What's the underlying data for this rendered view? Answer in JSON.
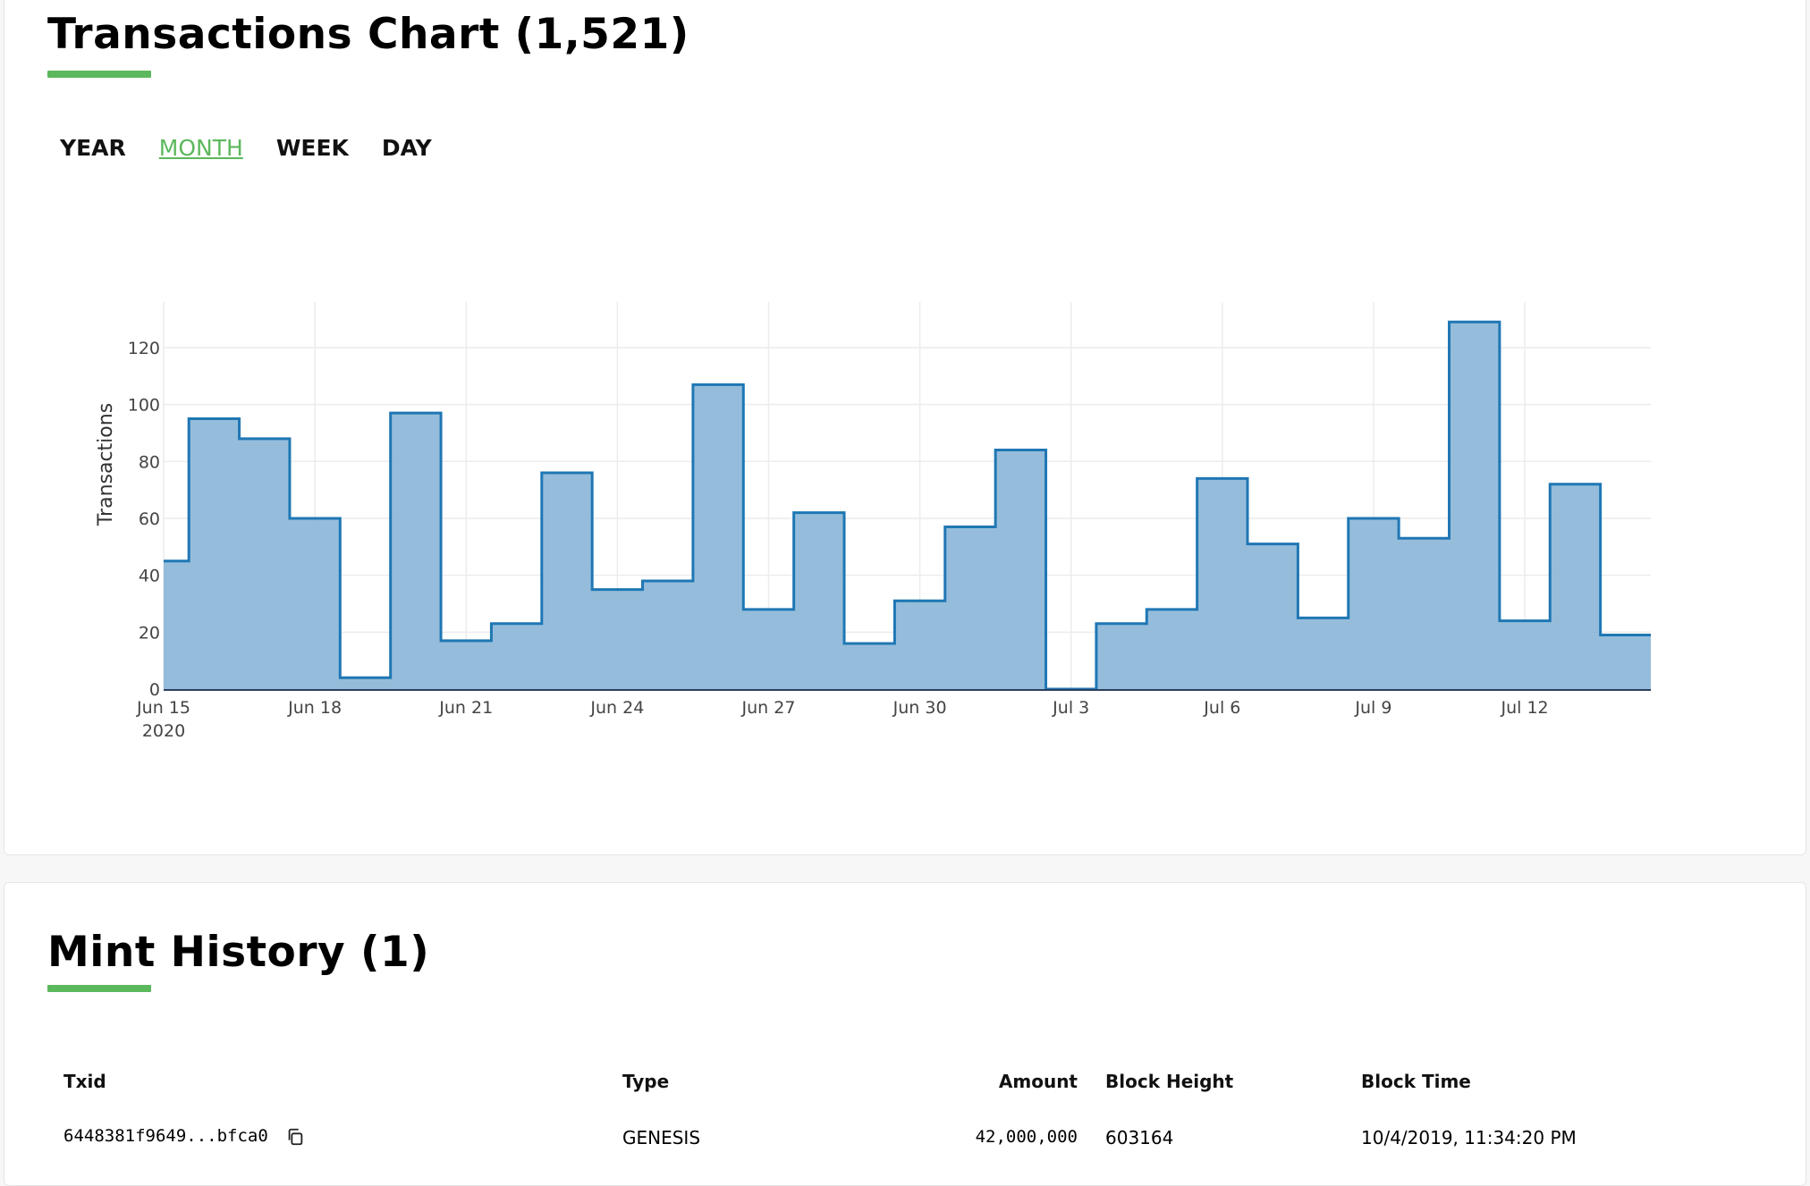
{
  "chart_card": {
    "title": "Transactions Chart (1,521)",
    "range_tabs": [
      {
        "label": "YEAR",
        "active": false
      },
      {
        "label": "MONTH",
        "active": true
      },
      {
        "label": "WEEK",
        "active": false
      },
      {
        "label": "DAY",
        "active": false
      }
    ]
  },
  "chart_data": {
    "type": "area",
    "step": true,
    "ylabel": "Transactions",
    "xlabel": "",
    "ylim": [
      0,
      136
    ],
    "yticks": [
      0,
      20,
      40,
      60,
      80,
      100,
      120
    ],
    "x_tick_labels": [
      "Jun 15",
      "Jun 18",
      "Jun 21",
      "Jun 24",
      "Jun 27",
      "Jun 30",
      "Jul 3",
      "Jul 6",
      "Jul 9",
      "Jul 12"
    ],
    "x_year_label": "2020",
    "dates": [
      "2020-06-15",
      "2020-06-16",
      "2020-06-17",
      "2020-06-18",
      "2020-06-19",
      "2020-06-20",
      "2020-06-21",
      "2020-06-22",
      "2020-06-23",
      "2020-06-24",
      "2020-06-25",
      "2020-06-26",
      "2020-06-27",
      "2020-06-28",
      "2020-06-29",
      "2020-06-30",
      "2020-07-01",
      "2020-07-02",
      "2020-07-03",
      "2020-07-04",
      "2020-07-05",
      "2020-07-06",
      "2020-07-07",
      "2020-07-08",
      "2020-07-09",
      "2020-07-10",
      "2020-07-11",
      "2020-07-12",
      "2020-07-13",
      "2020-07-14"
    ],
    "values": [
      45,
      95,
      88,
      60,
      4,
      97,
      17,
      23,
      76,
      35,
      38,
      107,
      28,
      62,
      16,
      31,
      57,
      84,
      0,
      23,
      28,
      74,
      51,
      25,
      60,
      53,
      129,
      24,
      72,
      19
    ],
    "grid": true,
    "colors": {
      "line": "#1f77b4",
      "fill": "#8fb9d9"
    }
  },
  "mint_card": {
    "title": "Mint History (1)",
    "columns": [
      "Txid",
      "Type",
      "Amount",
      "Block Height",
      "Block Time"
    ],
    "rows": [
      {
        "txid": "6448381f9649...bfca0",
        "type": "GENESIS",
        "amount": "42,000,000",
        "block_height": "603164",
        "block_time": "10/4/2019, 11:34:20 PM"
      }
    ]
  },
  "icons": {
    "copy": "copy-icon"
  },
  "colors": {
    "accent": "#5cb85c"
  }
}
